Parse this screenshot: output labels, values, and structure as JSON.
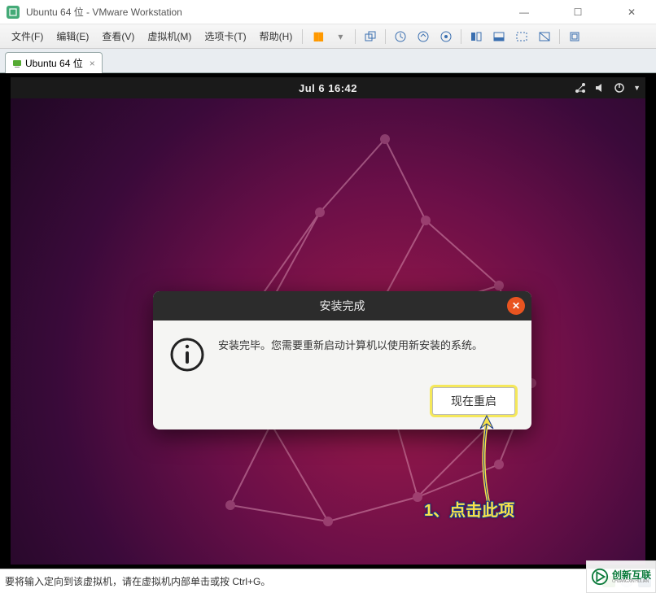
{
  "window": {
    "title": "Ubuntu 64 位 - VMware Workstation"
  },
  "menu": {
    "file": "文件(F)",
    "edit": "编辑(E)",
    "view": "查看(V)",
    "vm": "虚拟机(M)",
    "tabs": "选项卡(T)",
    "help": "帮助(H)"
  },
  "tab": {
    "label": "Ubuntu 64 位",
    "close": "×"
  },
  "ubuntu": {
    "datetime": "Jul 6  16:42"
  },
  "dialog": {
    "title": "安装完成",
    "message": "安装完毕。您需要重新启动计算机以使用新安装的系统。",
    "restart": "现在重启"
  },
  "annotation": {
    "text": "1、点击此项"
  },
  "status": {
    "text": "要将输入定向到该虚拟机，请在虚拟机内部单击或按 Ctrl+G。"
  },
  "watermark": {
    "cn": "创新互联",
    "en": "CHUANGXIN HULIAN"
  }
}
